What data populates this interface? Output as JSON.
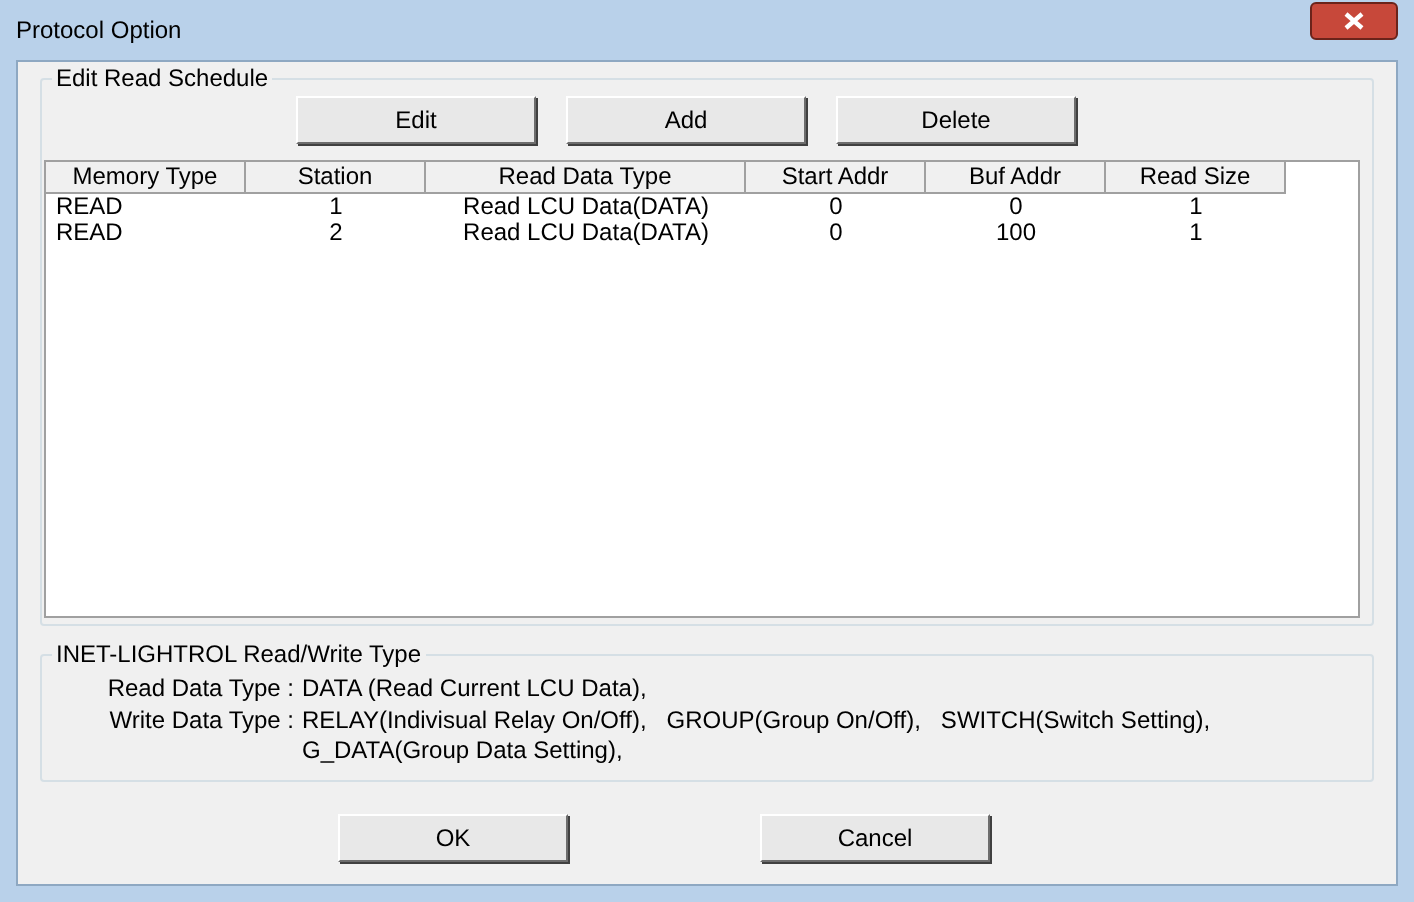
{
  "window": {
    "title": "Protocol Option"
  },
  "schedule": {
    "title": "Edit Read Schedule",
    "buttons": [
      "Edit",
      "Add",
      "Delete"
    ],
    "columns": [
      "Memory Type",
      "Station",
      "Read Data Type",
      "Start Addr",
      "Buf Addr",
      "Read Size"
    ],
    "rows": [
      [
        "READ",
        "1",
        "Read LCU Data(DATA)",
        "0",
        "0",
        "1"
      ],
      [
        "READ",
        "2",
        "Read LCU Data(DATA)",
        "0",
        "100",
        "1"
      ]
    ]
  },
  "types": {
    "title": "INET-LIGHTROL Read/Write Type",
    "entries": [
      {
        "label": "Read Data Type :",
        "lines": [
          "DATA (Read Current LCU Data),"
        ]
      },
      {
        "label": "Write Data Type :",
        "lines": [
          "RELAY(Indivisual Relay On/Off),   GROUP(Group On/Off),   SWITCH(Switch Setting),",
          "G_DATA(Group Data Setting),"
        ]
      }
    ]
  },
  "buttons": [
    "OK",
    "Cancel"
  ]
}
